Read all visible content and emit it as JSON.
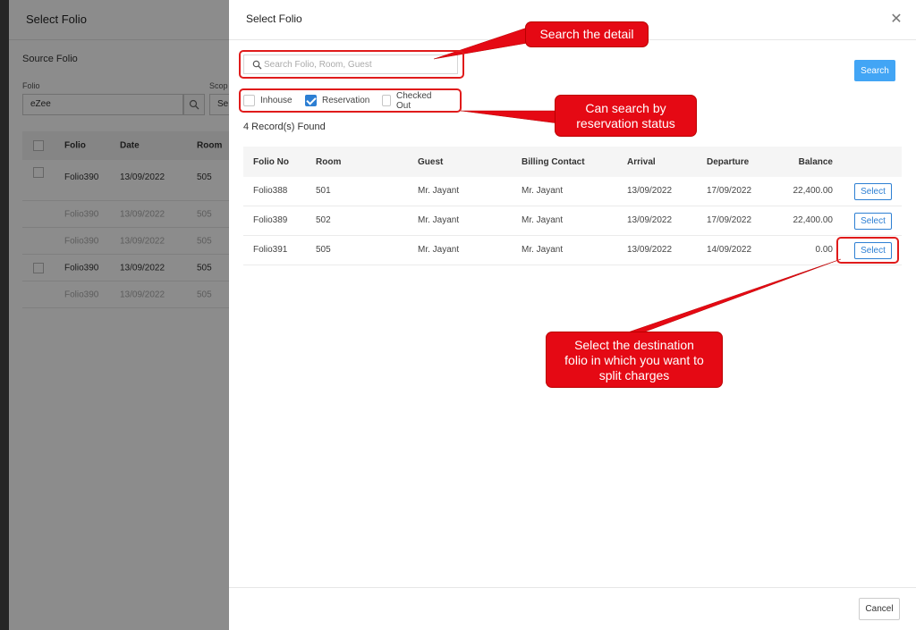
{
  "background": {
    "title": "Select Folio",
    "source_folio_label": "Source Folio",
    "folio_label": "Folio",
    "scope_label": "Scop",
    "folio_value": "eZee",
    "scope_value": "Se",
    "columns": [
      "Folio",
      "Date",
      "Room"
    ],
    "rows": [
      {
        "folio": "Folio390",
        "date": "13/09/2022",
        "room": "505",
        "checkbox": true,
        "faded": false
      },
      {
        "folio": "Folio390",
        "date": "13/09/2022",
        "room": "505",
        "checkbox": false,
        "faded": true
      },
      {
        "folio": "Folio390",
        "date": "13/09/2022",
        "room": "505",
        "checkbox": false,
        "faded": true
      },
      {
        "folio": "Folio390",
        "date": "13/09/2022",
        "room": "505",
        "checkbox": true,
        "faded": false
      },
      {
        "folio": "Folio390",
        "date": "13/09/2022",
        "room": "505",
        "checkbox": false,
        "faded": true
      }
    ]
  },
  "modal": {
    "title": "Select Folio",
    "close_glyph": "✕",
    "search_placeholder": "Search Folio, Room, Guest",
    "search_button": "Search",
    "filters": [
      {
        "label": "Inhouse",
        "checked": false
      },
      {
        "label": "Reservation",
        "checked": true
      },
      {
        "label": "Checked Out",
        "checked": false
      }
    ],
    "records_found": "4 Record(s) Found",
    "columns": {
      "folio_no": "Folio No",
      "room": "Room",
      "guest": "Guest",
      "billing_contact": "Billing Contact",
      "arrival": "Arrival",
      "departure": "Departure",
      "balance": "Balance"
    },
    "rows": [
      {
        "folio_no": "Folio388",
        "room": "501",
        "guest": "Mr. Jayant",
        "billing_contact": "Mr. Jayant",
        "arrival": "13/09/2022",
        "departure": "17/09/2022",
        "balance": "22,400.00",
        "action": "Select"
      },
      {
        "folio_no": "Folio389",
        "room": "502",
        "guest": "Mr. Jayant",
        "billing_contact": "Mr. Jayant",
        "arrival": "13/09/2022",
        "departure": "17/09/2022",
        "balance": "22,400.00",
        "action": "Select"
      },
      {
        "folio_no": "Folio391",
        "room": "505",
        "guest": "Mr. Jayant",
        "billing_contact": "Mr. Jayant",
        "arrival": "13/09/2022",
        "departure": "14/09/2022",
        "balance": "0.00",
        "action": "Select"
      }
    ],
    "cancel_button": "Cancel"
  },
  "annotations": {
    "search_detail": "Search the detail",
    "status_line1": "Can search by",
    "status_line2": "reservation status",
    "dest_line1": "Select the destination",
    "dest_line2": "folio in which you want to",
    "dest_line3": "split charges"
  },
  "colors": {
    "accent": "#42a5f5",
    "link_blue": "#2d7fd3",
    "annotation_red": "#e50914"
  }
}
